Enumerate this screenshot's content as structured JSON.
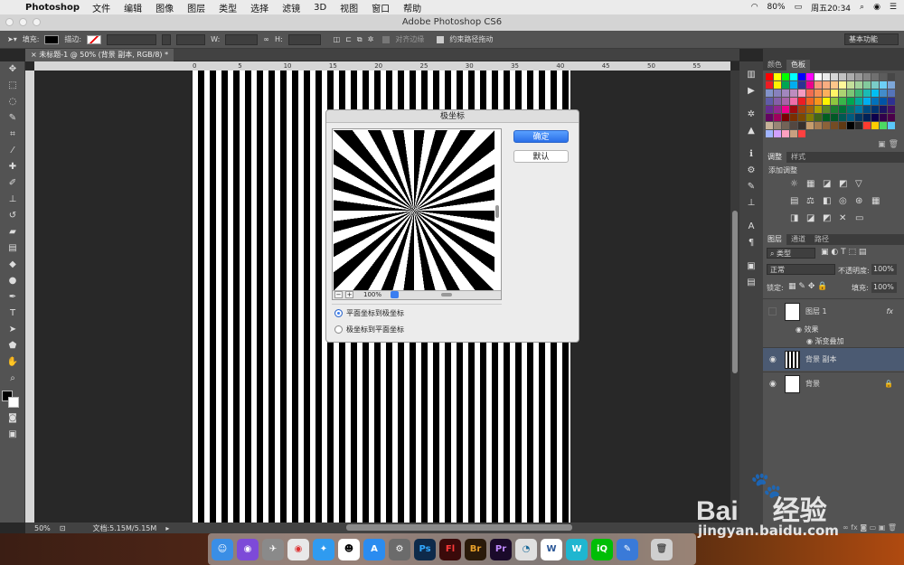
{
  "menubar": {
    "app": "Photoshop",
    "items": [
      "文件",
      "编辑",
      "图像",
      "图层",
      "类型",
      "选择",
      "滤镜",
      "3D",
      "视图",
      "窗口",
      "帮助"
    ],
    "battery": "80%",
    "clock": "周五20:34"
  },
  "window": {
    "title": "Adobe Photoshop CS6"
  },
  "options": {
    "fill_label": "填充:",
    "stroke_label": "描边:",
    "w_label": "W:",
    "h_label": "H:",
    "align_edges": "对齐边缘",
    "constrain_path": "约束路径拖动",
    "workspace": "基本功能"
  },
  "document": {
    "tab_title": "未标题-1 @ 50% (背景 副本, RGB/8) *",
    "ruler_ticks": [
      "0",
      "5",
      "10",
      "15",
      "20",
      "25",
      "30",
      "35",
      "40",
      "45",
      "50",
      "55"
    ],
    "zoom": "50%",
    "doc_size": "文档:5.15M/5.15M"
  },
  "dialog": {
    "title": "极坐标",
    "ok": "确定",
    "default": "默认",
    "zoom": "100%",
    "options": [
      "平面坐标到极坐标",
      "极坐标到平面坐标"
    ],
    "selected": 0
  },
  "panels": {
    "color_tabs": [
      "颜色",
      "色板"
    ],
    "adjust_tabs": [
      "调整",
      "样式"
    ],
    "adjust_title": "添加调整",
    "layer_tabs": [
      "图层",
      "通道",
      "路径"
    ],
    "kind": "类型",
    "blend_mode": "正常",
    "opacity_label": "不透明度:",
    "opacity": "100%",
    "lock_label": "锁定:",
    "fill_label": "填充:",
    "fill": "100%",
    "layers": [
      {
        "name": "图层 1",
        "fx": "fx"
      },
      {
        "name": "效果"
      },
      {
        "name": "渐变叠加"
      },
      {
        "name": "背景 副本"
      },
      {
        "name": "背景"
      }
    ]
  },
  "watermark": {
    "brand": "Bai",
    "brand2": "经验",
    "url": "jingyan.baidu.com"
  }
}
